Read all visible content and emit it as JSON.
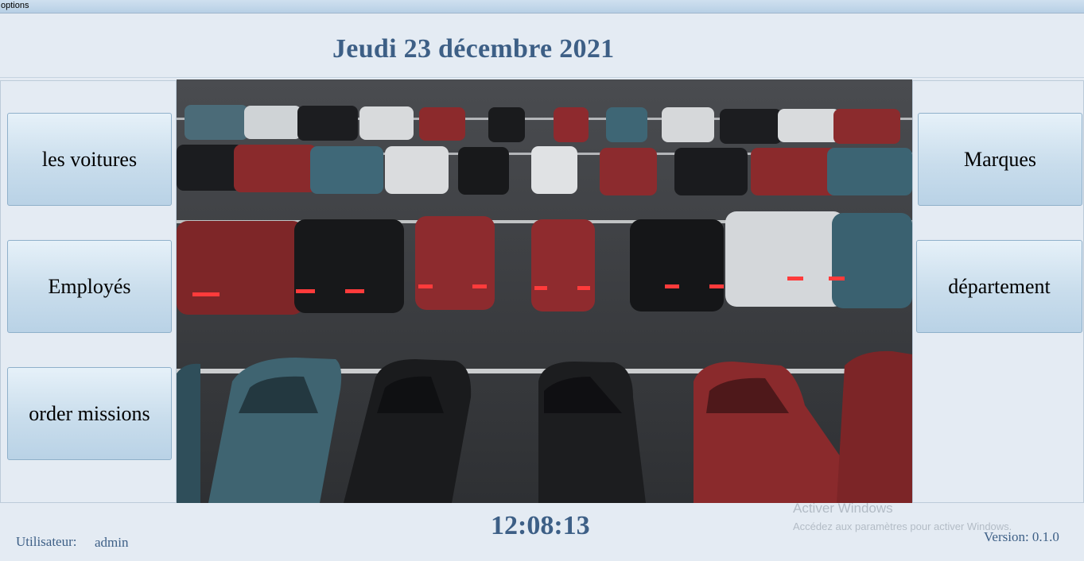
{
  "menu": {
    "options_label": "options"
  },
  "header": {
    "date": "Jeudi 23 décembre 2021"
  },
  "left_buttons": [
    {
      "label": "les voitures"
    },
    {
      "label": "Employés"
    },
    {
      "label": "order missions"
    }
  ],
  "right_buttons": [
    {
      "label": "Marques"
    },
    {
      "label": "département"
    }
  ],
  "photo": {
    "subject": "parking-lot-cars-image"
  },
  "footer": {
    "user_label": "Utilisateur:",
    "user_name": "admin",
    "clock": "12:08:13",
    "version": "Version: 0.1.0",
    "watermark_title": "Activer Windows",
    "watermark_sub": "Accédez aux paramètres pour activer Windows."
  },
  "colors": {
    "accent_text": "#3d5f86",
    "background": "#e4ebf3",
    "button_gradient_bottom": "#b9d2e6"
  }
}
